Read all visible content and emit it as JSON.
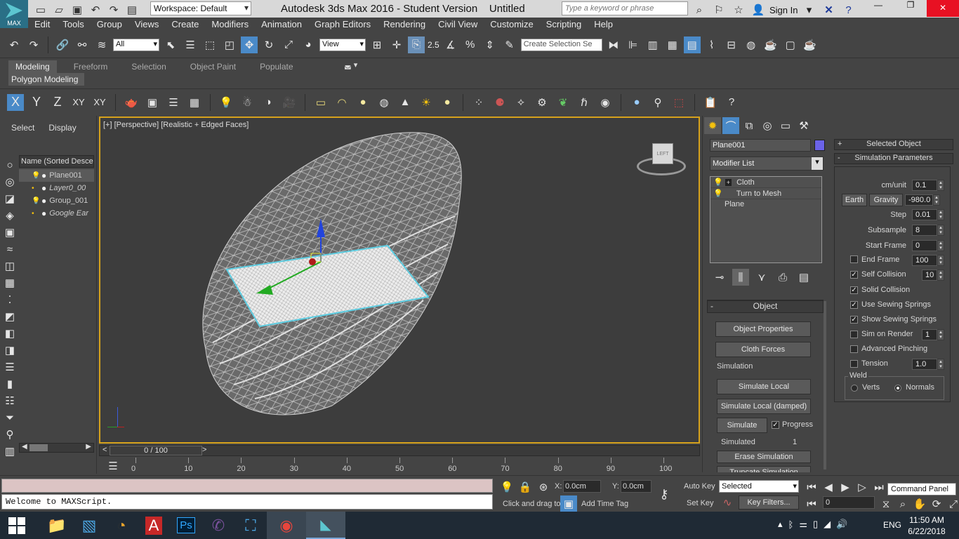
{
  "titlebar": {
    "logo_text": "MAX",
    "workspace_label": "Workspace: Default",
    "title": "Autodesk 3ds Max 2016 - Student Version",
    "file_name": "Untitled",
    "search_placeholder": "Type a keyword or phrase",
    "sign_in": "Sign In"
  },
  "menubar": {
    "items": [
      "Edit",
      "Tools",
      "Group",
      "Views",
      "Create",
      "Modifiers",
      "Animation",
      "Graph Editors",
      "Rendering",
      "Civil View",
      "Customize",
      "Scripting",
      "Help"
    ]
  },
  "main_toolbar": {
    "filter_value": "All",
    "ref_coord": "View",
    "snap_value": "2.5",
    "selection_set_placeholder": "Create Selection Se"
  },
  "ribbon": {
    "tabs": [
      "Modeling",
      "Freeform",
      "Selection",
      "Object Paint",
      "Populate"
    ],
    "active_tab": "Modeling",
    "panel_label": "Polygon Modeling"
  },
  "axis_toolbar": {
    "x": "X",
    "y": "Y",
    "z": "Z",
    "xy": "XY",
    "xy2": "XY"
  },
  "scene_explorer": {
    "tabs": [
      "Select",
      "Display"
    ],
    "column_header": "Name (Sorted Descen",
    "items": [
      "Plane001",
      "Layer0_00",
      "Group_001",
      "Google Ear"
    ]
  },
  "viewport": {
    "label": "[+] [Perspective] [Realistic + Edged Faces]",
    "viewcube_face": "LEFT"
  },
  "command_panel": {
    "object_name": "Plane001",
    "object_color": "#6b63e8",
    "modifier_list": "Modifier List",
    "stack": [
      "Cloth",
      "Turn to Mesh",
      "Plane"
    ],
    "object_rollout": {
      "title": "Object",
      "buttons": [
        "Object Properties",
        "Cloth Forces"
      ],
      "simulation_group": "Simulation",
      "sim_buttons": [
        "Simulate Local",
        "Simulate Local (damped)"
      ],
      "simulate": "Simulate",
      "progress_label": "Progress",
      "simulated_label": "Simulated",
      "simulated_value": "1",
      "erase": "Erase Simulation",
      "truncate": "Truncate Simulation"
    }
  },
  "sim_params": {
    "selected_object": "Selected Object",
    "rollout_title": "Simulation Parameters",
    "cm_unit_label": "cm/unit",
    "cm_unit": "0.1",
    "earth_button": "Earth",
    "gravity_label": "Gravity",
    "gravity": "-980.0",
    "step_label": "Step",
    "step": "0.01",
    "subsample_label": "Subsample",
    "subsample": "8",
    "start_frame_label": "Start Frame",
    "start_frame": "0",
    "end_frame_label": "End Frame",
    "end_frame": "100",
    "self_collision_label": "Self Collision",
    "self_collision": "10",
    "solid_collision_label": "Solid Collision",
    "sewing_springs_label": "Use Sewing Springs",
    "show_sewing_label": "Show Sewing Springs",
    "sim_on_render_label": "Sim on Render",
    "sim_on_render": "1",
    "adv_pinching_label": "Advanced Pinching",
    "tension_label": "Tension",
    "tension": "1.0",
    "weld_label": "Weld",
    "verts_label": "Verts",
    "normals_label": "Normals"
  },
  "timeline": {
    "frame_display": "0 / 100",
    "ticks": [
      "0",
      "10",
      "20",
      "30",
      "40",
      "50",
      "60",
      "70",
      "80",
      "90",
      "100"
    ]
  },
  "status": {
    "maxscript_text": "Welcome to MAXScript.",
    "prompt": "Click and drag to",
    "x_label": "X:",
    "x_value": "0.0cm",
    "y_label": "Y:",
    "y_value": "0.0cm",
    "add_time_tag": "Add Time Tag",
    "auto_key": "Auto Key",
    "set_key": "Set Key",
    "selected_option": "Selected",
    "key_filters": "Key Filters...",
    "frame_value": "0",
    "tooltip": "Command Panel"
  },
  "taskbar": {
    "language": "ENG",
    "time": "11:50 AM",
    "date": "6/22/2018"
  }
}
